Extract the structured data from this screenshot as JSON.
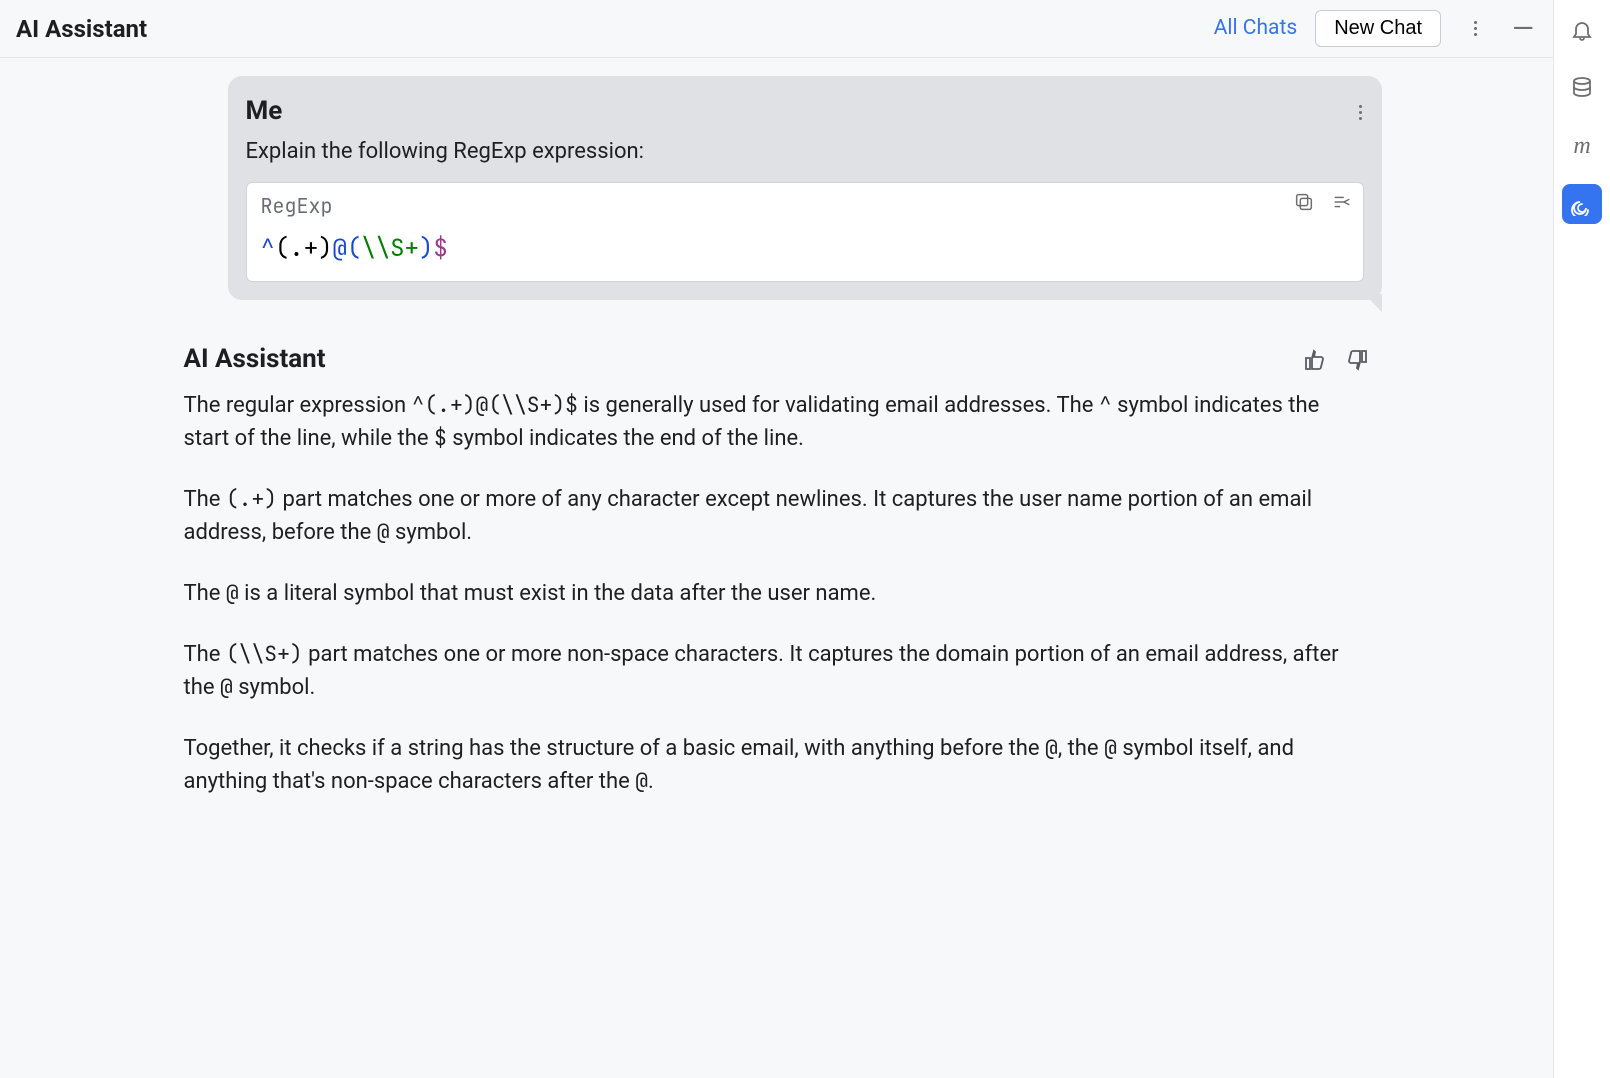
{
  "header": {
    "title": "AI Assistant",
    "all_chats_label": "All Chats",
    "new_chat_label": "New Chat"
  },
  "sidebar": {
    "items": [
      {
        "name": "notifications-bell-icon"
      },
      {
        "name": "database-icon"
      },
      {
        "name": "m-letter-icon"
      },
      {
        "name": "ai-assistant-spiral-icon",
        "active": true
      }
    ]
  },
  "user_message": {
    "sender": "Me",
    "prompt": "Explain the following RegExp expression:",
    "code_lang": "RegExp",
    "code_raw": "^(.+)@(\\\\S+)$",
    "code_tokens": [
      {
        "t": "^",
        "c": "anchor"
      },
      {
        "t": "(.+)",
        "c": "literal"
      },
      {
        "t": "@(",
        "c": "anchor"
      },
      {
        "t": "\\\\S+",
        "c": "escape"
      },
      {
        "t": ")",
        "c": "anchor"
      },
      {
        "t": "$",
        "c": "end"
      }
    ]
  },
  "assistant_reply": {
    "name": "AI Assistant",
    "paragraphs": [
      "The regular expression ^(.+)@(\\\\S+)$ is generally used for validating email addresses. The ^ symbol indicates the start of the line, while the $ symbol indicates the end of the line.",
      "The (.+) part matches one or more of any character except newlines. It captures the user name portion of an email address, before the @ symbol.",
      "The @ is a literal symbol that must exist in the data after the user name.",
      "The (\\\\S+) part matches one or more non-space characters. It captures the domain portion of an email address, after the @ symbol.",
      "Together, it checks if a string has the structure of a basic email, with anything before the @, the @ symbol itself, and anything that's non-space characters after the @."
    ],
    "inline_code_spans": [
      "^(.+)@(\\\\S+)$",
      "^",
      "$",
      "(.+)",
      "@",
      "@",
      "(\\\\S+)",
      "@",
      "@",
      "@",
      "@"
    ]
  }
}
